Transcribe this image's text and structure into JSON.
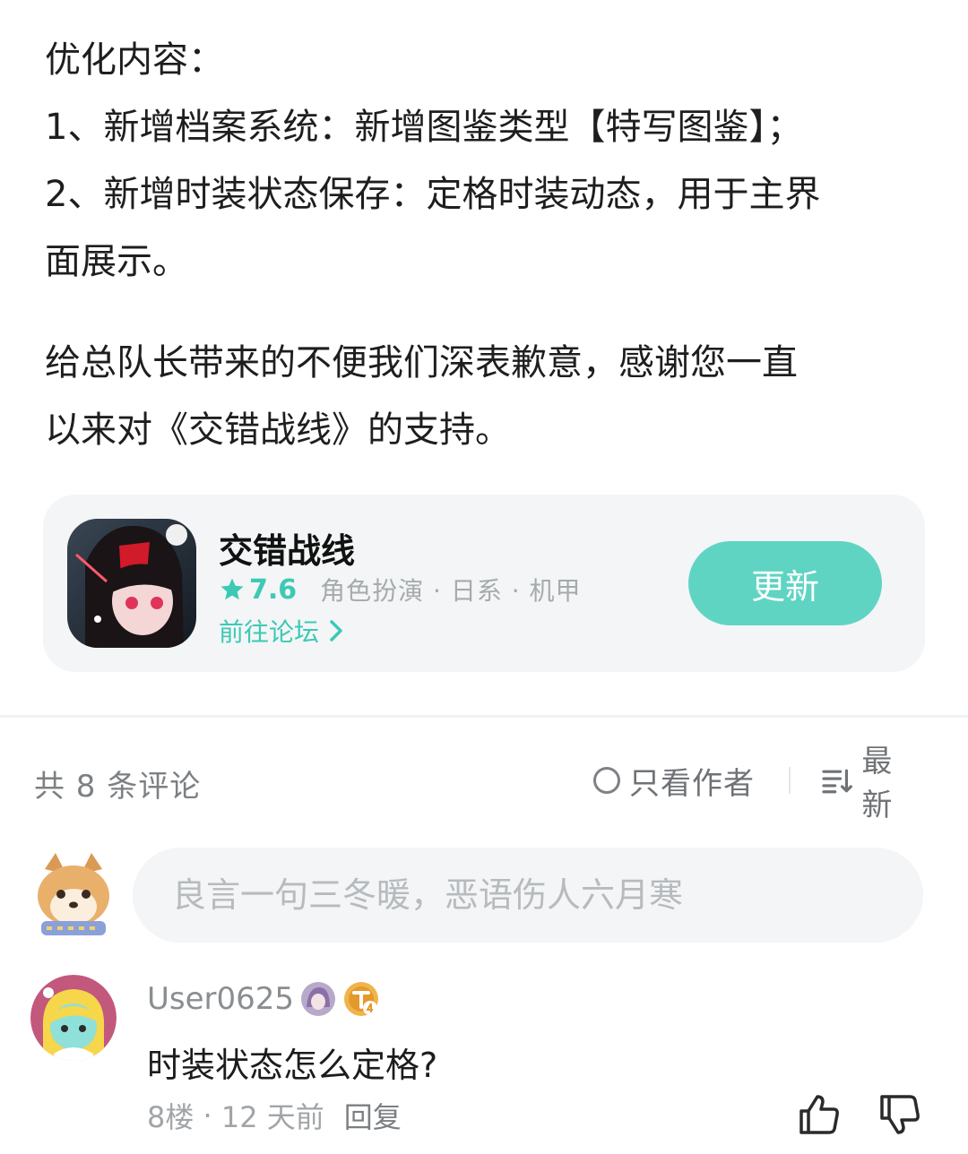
{
  "article": {
    "lines": [
      "优化内容：",
      "1、新增档案系统：新增图鉴类型【特写图鉴】；",
      "2、新增时装状态保存：定格时装动态，用于主界",
      "面展示。",
      "给总队长带来的不便我们深表歉意，感谢您一直",
      "以来对《交错战线》的支持。"
    ]
  },
  "app_card": {
    "name": "交错战线",
    "rating": "7.6",
    "tags": "角色扮演 · 日系 · 机甲",
    "forum_link": "前往论坛",
    "update_button": "更新",
    "accent_color": "#5fd4c3"
  },
  "comments_header": {
    "count_label": "共 8 条评论",
    "author_only_label": "只看作者",
    "sort_label": "最新"
  },
  "comment_input": {
    "placeholder": "良言一句三冬暖，恶语伤人六月寒"
  },
  "comments": [
    {
      "username": "User0625",
      "text": "时装状态怎么定格?",
      "floor": "8楼",
      "time": "12 天前",
      "reply_label": "回复"
    }
  ],
  "icons": {
    "rating": "star-icon",
    "forum": "chevron-right-icon",
    "author_only": "radio-circle-icon",
    "sort": "sort-lines-icon",
    "like": "thumb-up-icon",
    "dislike": "thumb-down-icon"
  }
}
